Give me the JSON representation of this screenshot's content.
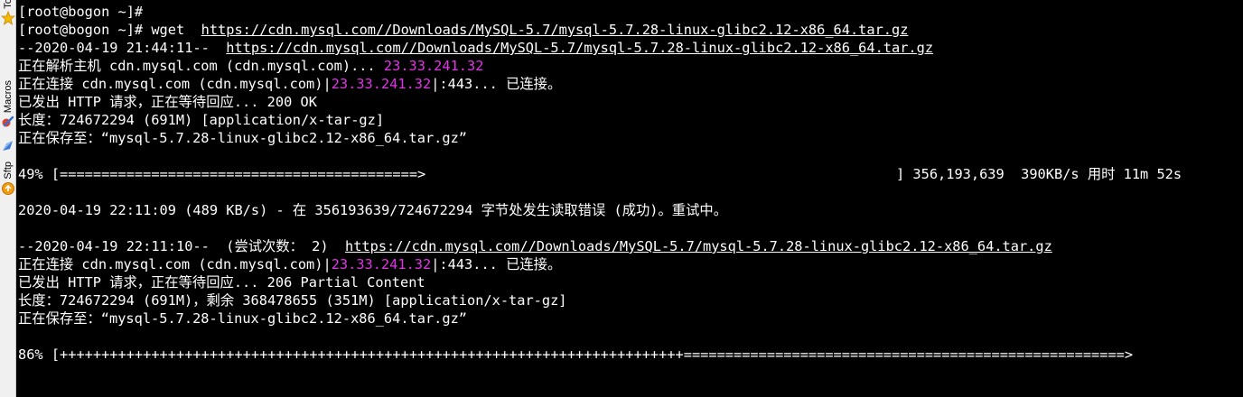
{
  "sidebar": {
    "tabs": [
      {
        "label": "Tools",
        "icon": "star-icon"
      },
      {
        "label": "Macros",
        "icon": "macro-icon"
      },
      {
        "label": "Sftp",
        "icon": "sftp-icon"
      }
    ]
  },
  "colors": {
    "background": "#000000",
    "text": "#ffffff",
    "ip_highlight": "#e233e6"
  },
  "terminal": {
    "l1": "[root@bogon ~]#",
    "l2_prompt": "[root@bogon ~]# wget  ",
    "url": "https://cdn.mysql.com//Downloads/MySQL-5.7/mysql-5.7.28-linux-glibc2.12-x86_64.tar.gz",
    "l3_prefix": "--2020-04-19 21:44:11--  ",
    "l4_prefix": "正在解析主机 cdn.mysql.com (cdn.mysql.com)... ",
    "ip": "23.33.241.32",
    "connect_prefix": "正在连接 cdn.mysql.com (cdn.mysql.com)|",
    "connect_suffix": "|:443... 已连接。",
    "l6": "已发出 HTTP 请求，正在等待回应... 200 OK",
    "l7": "长度：724672294 (691M) [application/x-tar-gz]",
    "saving": "正在保存至：“mysql-5.7.28-linux-glibc2.12-x86_64.tar.gz”",
    "progress1_left": "49% [===========================================>",
    "progress1_right": "] 356,193,639  390KB/s 用时 11m 52s",
    "error_line": "2020-04-19 22:11:09 (489 KB/s) - 在 356193639/724672294 字节处发生读取错误 (成功)。重试中。",
    "retry_prefix": "--2020-04-19 22:11:10--  (尝试次数： 2)  ",
    "l15": "已发出 HTTP 请求，正在等待回应... 206 Partial Content",
    "l16": "长度：724672294 (691M)，剩余 368478655 (351M) [application/x-tar-gz]",
    "progress2": "86% [+++++++++++++++++++++++++++++++++++++++++++++++++++++++++++++++++++++++++++=====================================================>",
    "progress1_percent": 49,
    "progress2_percent": 86
  }
}
